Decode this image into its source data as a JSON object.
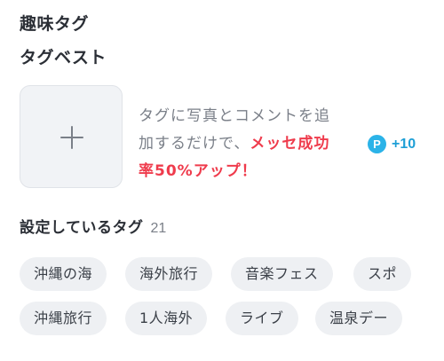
{
  "section_title": "趣味タグ",
  "best": {
    "title": "タグベスト",
    "add_icon": "plus-icon",
    "promo_line1": "タグに写真とコメントを追",
    "promo_line2_prefix": "加するだけで、",
    "promo_highlight_1": "メッセ成功",
    "promo_highlight_2": "率50%アップ！",
    "points_icon_letter": "P",
    "points_value": "+10"
  },
  "tags": {
    "label": "設定しているタグ",
    "count": "21",
    "row1": [
      "沖縄の海",
      "海外旅行",
      "音楽フェス",
      "スポ"
    ],
    "row2": [
      "沖縄旅行",
      "1人海外",
      "ライブ",
      "温泉デー"
    ]
  },
  "colors": {
    "accent_red": "#ef3b4c",
    "points_blue": "#2bb3e8",
    "chip_bg": "#eef0f3"
  }
}
